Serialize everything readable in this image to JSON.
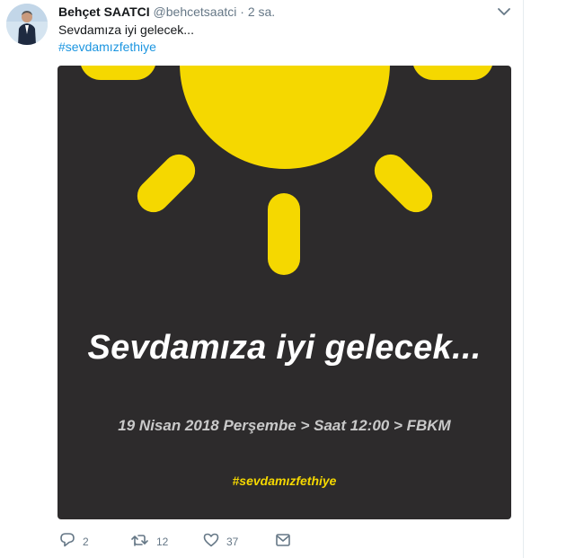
{
  "tweet": {
    "author_name": "Behçet SAATCI",
    "author_handle": "@behcetsaatci",
    "separator": "·",
    "timestamp": "2 sa.",
    "text": "Sevdamıza iyi gelecek...",
    "hashtag": "#sevdamızfethiye"
  },
  "media": {
    "slogan": "Sevdamıza iyi gelecek...",
    "event_line": "19 Nisan 2018 Perşembe > Saat 12:00 > FBKM",
    "hashtag": "#sevdamızfethiye",
    "background_color": "#2d2b2c",
    "sun_color": "#f5d800"
  },
  "actions": {
    "replies": "2",
    "retweets": "12",
    "likes": "37"
  },
  "icons": [
    "avatar",
    "chevron-down-icon",
    "reply-icon",
    "retweet-icon",
    "like-icon",
    "message-icon"
  ]
}
